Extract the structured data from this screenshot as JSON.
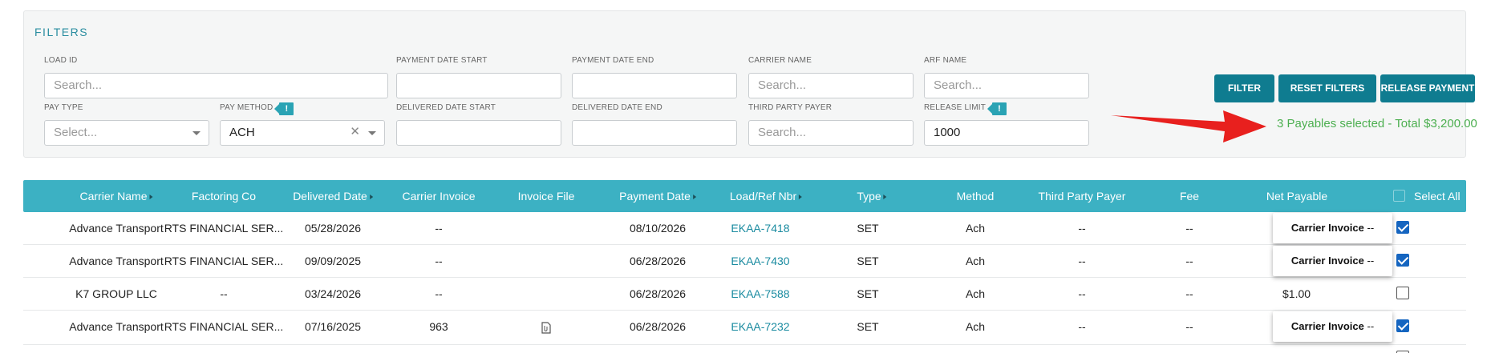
{
  "filters": {
    "title": "FILTERS",
    "load_id": {
      "label": "LOAD ID",
      "placeholder": "Search..."
    },
    "payment_date_start": {
      "label": "PAYMENT DATE START"
    },
    "payment_date_end": {
      "label": "PAYMENT DATE END"
    },
    "carrier_name": {
      "label": "CARRIER NAME",
      "placeholder": "Search..."
    },
    "arf_name": {
      "label": "ARF NAME",
      "placeholder": "Search..."
    },
    "pay_type": {
      "label": "PAY TYPE",
      "placeholder": "Select..."
    },
    "pay_method": {
      "label": "PAY METHOD",
      "value": "ACH",
      "badge": "!"
    },
    "delivered_date_start": {
      "label": "DELIVERED DATE START"
    },
    "delivered_date_end": {
      "label": "DELIVERED DATE END"
    },
    "third_party_payer": {
      "label": "THIRD PARTY PAYER",
      "placeholder": "Search..."
    },
    "release_limit": {
      "label": "RELEASE LIMIT",
      "value": "1000",
      "badge": "!"
    },
    "buttons": {
      "filter": "FILTER",
      "reset": "RESET FILTERS",
      "release": "RELEASE PAYMENT"
    },
    "summary": "3 Payables selected - Total $3,200.00"
  },
  "table": {
    "columns": [
      "Carrier Name",
      "Factoring Co",
      "Delivered Date",
      "Carrier Invoice",
      "Invoice File",
      "Payment Date",
      "Load/Ref Nbr",
      "Type",
      "Method",
      "Third Party Payer",
      "Fee",
      "Net Payable"
    ],
    "select_all": "Select All",
    "rows": [
      {
        "carrier": "Advance Transport",
        "factoring": "RTS FINANCIAL SER...",
        "delivered": "05/28/2026",
        "invoice": "--",
        "file": "",
        "payment": "08/10/2026",
        "load": "EKAA-7418",
        "type": "SET",
        "method": "Ach",
        "third_party": "--",
        "fee": "--",
        "net": "",
        "selected": true,
        "tooltip": "Carrier Invoice",
        "tooltip_dash": "--"
      },
      {
        "carrier": "Advance Transport",
        "factoring": "RTS FINANCIAL SER...",
        "delivered": "09/09/2025",
        "invoice": "--",
        "file": "",
        "payment": "06/28/2026",
        "load": "EKAA-7430",
        "type": "SET",
        "method": "Ach",
        "third_party": "--",
        "fee": "--",
        "net": "",
        "selected": true,
        "tooltip": "Carrier Invoice",
        "tooltip_dash": "--"
      },
      {
        "carrier": "K7 GROUP LLC",
        "factoring": "--",
        "delivered": "03/24/2026",
        "invoice": "--",
        "file": "",
        "payment": "06/28/2026",
        "load": "EKAA-7588",
        "type": "SET",
        "method": "Ach",
        "third_party": "--",
        "fee": "--",
        "net": "$1.00",
        "selected": false
      },
      {
        "carrier": "Advance Transport",
        "factoring": "RTS FINANCIAL SER...",
        "delivered": "07/16/2025",
        "invoice": "963",
        "file": "paperclip",
        "payment": "06/28/2026",
        "load": "EKAA-7232",
        "type": "SET",
        "method": "Ach",
        "third_party": "--",
        "fee": "--",
        "net": "",
        "selected": true,
        "tooltip": "Carrier Invoice",
        "tooltip_dash": "--"
      }
    ]
  },
  "colors": {
    "accent": "#0f7c90",
    "header": "#3cb1c3",
    "link": "#1a8ba0",
    "success": "#4caf50",
    "arrow": "#e8201e"
  }
}
